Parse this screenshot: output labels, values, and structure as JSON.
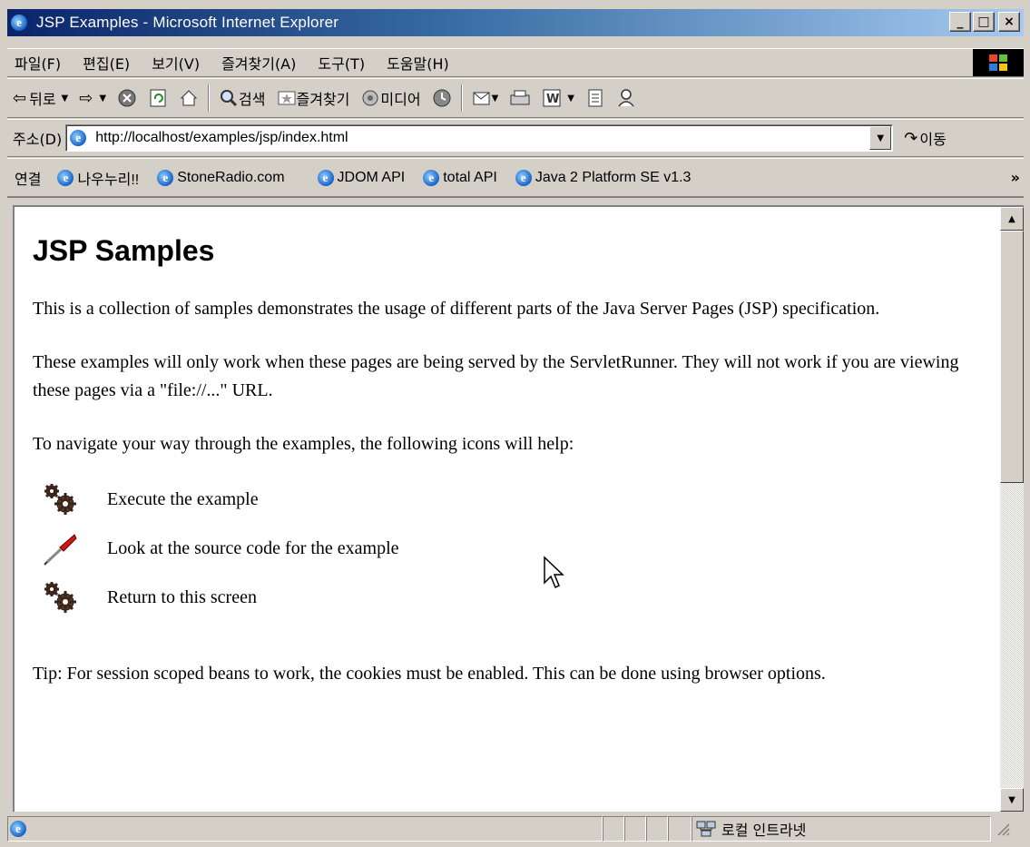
{
  "window": {
    "title": "JSP Examples - Microsoft Internet Explorer",
    "minimize_label": "_",
    "maximize_label": "□",
    "close_label": "×"
  },
  "menu": [
    "파일(F)",
    "편집(E)",
    "보기(V)",
    "즐겨찾기(A)",
    "도구(T)",
    "도움말(H)"
  ],
  "toolbar": {
    "back_label": "뒤로",
    "search_label": "검색",
    "favorites_label": "즐겨찾기",
    "media_label": "미디어"
  },
  "address": {
    "label": "주소(D)",
    "url": "http://localhost/examples/jsp/index.html",
    "go_label": "이동"
  },
  "links": {
    "label": "연결",
    "items": [
      "나우누리!!",
      "StoneRadio.com",
      "JDOM API",
      "total API",
      "Java 2 Platform SE v1.3"
    ],
    "more": "»"
  },
  "page": {
    "heading": "JSP Samples",
    "para1": "This is a collection of samples demonstrates the usage of different parts of the Java Server Pages (JSP) specification.",
    "para2": "These examples will only work when these pages are being served by the ServletRunner. They will not work if you are viewing these pages via a \"file://...\" URL.",
    "para3": "To navigate your way through the examples, the following icons will help:",
    "icons": [
      {
        "icon": "execute-gears-icon",
        "text": "Execute the example"
      },
      {
        "icon": "source-code-screwdriver-icon",
        "text": "Look at the source code for the example"
      },
      {
        "icon": "return-gears-icon",
        "text": "Return to this screen"
      }
    ],
    "tip": "Tip: For session scoped beans to work, the cookies must be enabled. This can be done using browser options."
  },
  "status": {
    "zone": "로컬 인트라넷"
  }
}
